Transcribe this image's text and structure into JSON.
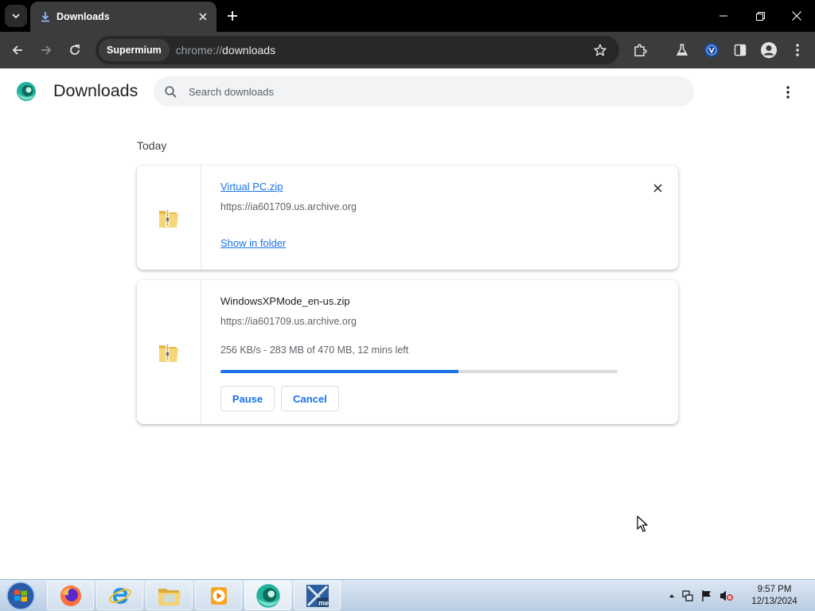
{
  "browser": {
    "tab_title": "Downloads",
    "chip_label": "Supermium",
    "url_scheme": "chrome://",
    "url_host": "downloads"
  },
  "page": {
    "title": "Downloads",
    "search_placeholder": "Search downloads",
    "date_group": "Today"
  },
  "downloads": [
    {
      "file_name": "Virtual PC.zip",
      "source": "https://ia601709.us.archive.org",
      "action": "Show in folder",
      "state": "complete"
    },
    {
      "file_name": "WindowsXPMode_en-us.zip",
      "source": "https://ia601709.us.archive.org",
      "status": "256 KB/s - 283 MB of 470 MB, 12 mins left",
      "progress": 0.6,
      "pause_label": "Pause",
      "cancel_label": "Cancel",
      "state": "in-progress"
    }
  ],
  "taskbar": {
    "time": "9:57 PM",
    "date": "12/13/2024",
    "apps": [
      "firefox",
      "internet-explorer",
      "file-explorer",
      "media-player",
      "supermium",
      "virtual-pc"
    ]
  },
  "colors": {
    "accent": "#1a73e8",
    "tabstrip": "#000000",
    "toolbar": "#3c3c3c"
  }
}
